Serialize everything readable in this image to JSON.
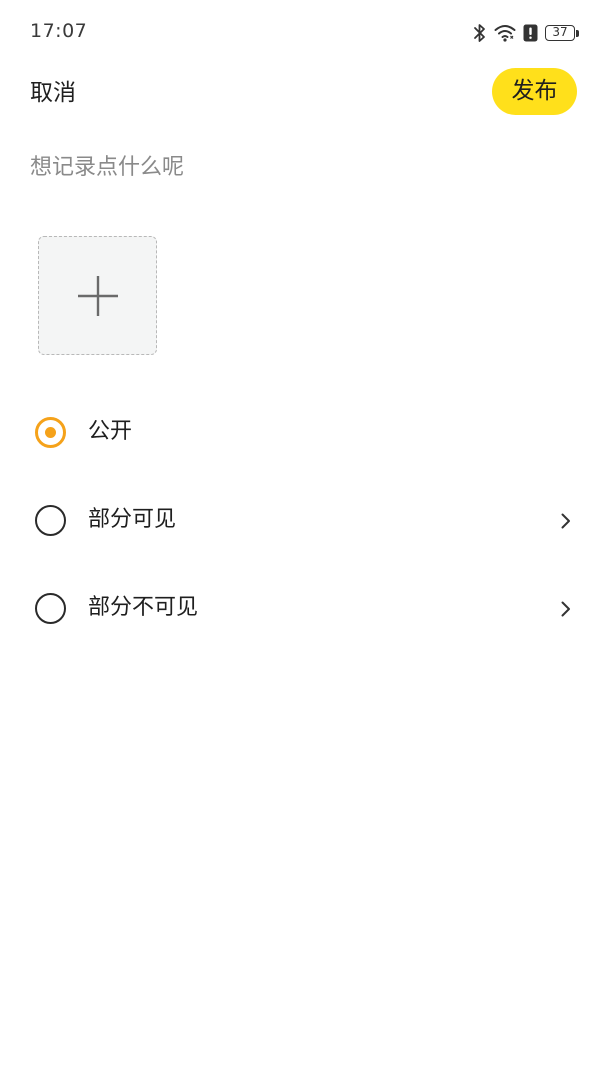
{
  "status_bar": {
    "time": "17:07",
    "icons": [
      "bluetooth-icon",
      "wifi-icon",
      "alert-icon",
      "battery-icon"
    ],
    "battery_level": "37"
  },
  "header": {
    "cancel_label": "取消",
    "publish_label": "发布",
    "publish_color": "#ffe01b"
  },
  "editor": {
    "text_value": "",
    "placeholder": "想记录点什么呢",
    "add_image_icon": "plus-icon"
  },
  "visibility": {
    "accent_color": "#f5a21a",
    "options": [
      {
        "label": "公开",
        "selected": true,
        "has_chevron": false
      },
      {
        "label": "部分可见",
        "selected": false,
        "has_chevron": true
      },
      {
        "label": "部分不可见",
        "selected": false,
        "has_chevron": true
      }
    ]
  }
}
